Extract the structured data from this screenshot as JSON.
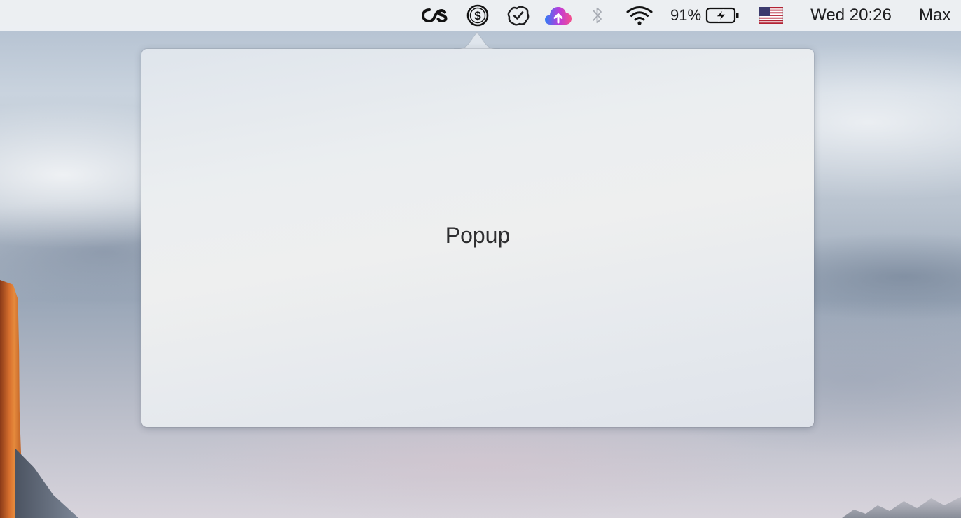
{
  "menubar": {
    "lastfm_icon": "lastfm-icon",
    "dollar_icon": "dollar-circle-icon",
    "checklist_icon": "check-badge-icon",
    "cloud_icon": "cloud-upload-icon",
    "bluetooth_icon": "bluetooth-icon",
    "wifi_icon": "wifi-icon",
    "battery_percent": "91%",
    "battery_icon": "battery-charging-icon",
    "input_source_icon": "us-flag-icon",
    "clock": "Wed 20:26",
    "user": "Max"
  },
  "popup": {
    "label": "Popup"
  },
  "colors": {
    "menubar_bg": "#eef0f4",
    "text": "#1d1d1f",
    "cloud_gradient": [
      "#2f7cf6",
      "#c03bd8",
      "#f4508d"
    ]
  }
}
